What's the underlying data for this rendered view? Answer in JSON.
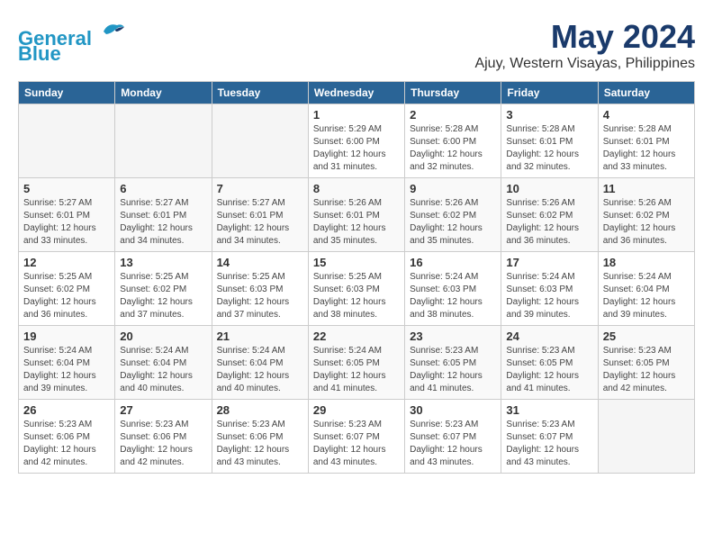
{
  "header": {
    "logo_line1": "General",
    "logo_line2": "Blue",
    "main_title": "May 2024",
    "subtitle": "Ajuy, Western Visayas, Philippines"
  },
  "days_of_week": [
    "Sunday",
    "Monday",
    "Tuesday",
    "Wednesday",
    "Thursday",
    "Friday",
    "Saturday"
  ],
  "weeks": [
    [
      {
        "day": "",
        "info": ""
      },
      {
        "day": "",
        "info": ""
      },
      {
        "day": "",
        "info": ""
      },
      {
        "day": "1",
        "info": "Sunrise: 5:29 AM\nSunset: 6:00 PM\nDaylight: 12 hours\nand 31 minutes."
      },
      {
        "day": "2",
        "info": "Sunrise: 5:28 AM\nSunset: 6:00 PM\nDaylight: 12 hours\nand 32 minutes."
      },
      {
        "day": "3",
        "info": "Sunrise: 5:28 AM\nSunset: 6:01 PM\nDaylight: 12 hours\nand 32 minutes."
      },
      {
        "day": "4",
        "info": "Sunrise: 5:28 AM\nSunset: 6:01 PM\nDaylight: 12 hours\nand 33 minutes."
      }
    ],
    [
      {
        "day": "5",
        "info": "Sunrise: 5:27 AM\nSunset: 6:01 PM\nDaylight: 12 hours\nand 33 minutes."
      },
      {
        "day": "6",
        "info": "Sunrise: 5:27 AM\nSunset: 6:01 PM\nDaylight: 12 hours\nand 34 minutes."
      },
      {
        "day": "7",
        "info": "Sunrise: 5:27 AM\nSunset: 6:01 PM\nDaylight: 12 hours\nand 34 minutes."
      },
      {
        "day": "8",
        "info": "Sunrise: 5:26 AM\nSunset: 6:01 PM\nDaylight: 12 hours\nand 35 minutes."
      },
      {
        "day": "9",
        "info": "Sunrise: 5:26 AM\nSunset: 6:02 PM\nDaylight: 12 hours\nand 35 minutes."
      },
      {
        "day": "10",
        "info": "Sunrise: 5:26 AM\nSunset: 6:02 PM\nDaylight: 12 hours\nand 36 minutes."
      },
      {
        "day": "11",
        "info": "Sunrise: 5:26 AM\nSunset: 6:02 PM\nDaylight: 12 hours\nand 36 minutes."
      }
    ],
    [
      {
        "day": "12",
        "info": "Sunrise: 5:25 AM\nSunset: 6:02 PM\nDaylight: 12 hours\nand 36 minutes."
      },
      {
        "day": "13",
        "info": "Sunrise: 5:25 AM\nSunset: 6:02 PM\nDaylight: 12 hours\nand 37 minutes."
      },
      {
        "day": "14",
        "info": "Sunrise: 5:25 AM\nSunset: 6:03 PM\nDaylight: 12 hours\nand 37 minutes."
      },
      {
        "day": "15",
        "info": "Sunrise: 5:25 AM\nSunset: 6:03 PM\nDaylight: 12 hours\nand 38 minutes."
      },
      {
        "day": "16",
        "info": "Sunrise: 5:24 AM\nSunset: 6:03 PM\nDaylight: 12 hours\nand 38 minutes."
      },
      {
        "day": "17",
        "info": "Sunrise: 5:24 AM\nSunset: 6:03 PM\nDaylight: 12 hours\nand 39 minutes."
      },
      {
        "day": "18",
        "info": "Sunrise: 5:24 AM\nSunset: 6:04 PM\nDaylight: 12 hours\nand 39 minutes."
      }
    ],
    [
      {
        "day": "19",
        "info": "Sunrise: 5:24 AM\nSunset: 6:04 PM\nDaylight: 12 hours\nand 39 minutes."
      },
      {
        "day": "20",
        "info": "Sunrise: 5:24 AM\nSunset: 6:04 PM\nDaylight: 12 hours\nand 40 minutes."
      },
      {
        "day": "21",
        "info": "Sunrise: 5:24 AM\nSunset: 6:04 PM\nDaylight: 12 hours\nand 40 minutes."
      },
      {
        "day": "22",
        "info": "Sunrise: 5:24 AM\nSunset: 6:05 PM\nDaylight: 12 hours\nand 41 minutes."
      },
      {
        "day": "23",
        "info": "Sunrise: 5:23 AM\nSunset: 6:05 PM\nDaylight: 12 hours\nand 41 minutes."
      },
      {
        "day": "24",
        "info": "Sunrise: 5:23 AM\nSunset: 6:05 PM\nDaylight: 12 hours\nand 41 minutes."
      },
      {
        "day": "25",
        "info": "Sunrise: 5:23 AM\nSunset: 6:05 PM\nDaylight: 12 hours\nand 42 minutes."
      }
    ],
    [
      {
        "day": "26",
        "info": "Sunrise: 5:23 AM\nSunset: 6:06 PM\nDaylight: 12 hours\nand 42 minutes."
      },
      {
        "day": "27",
        "info": "Sunrise: 5:23 AM\nSunset: 6:06 PM\nDaylight: 12 hours\nand 42 minutes."
      },
      {
        "day": "28",
        "info": "Sunrise: 5:23 AM\nSunset: 6:06 PM\nDaylight: 12 hours\nand 43 minutes."
      },
      {
        "day": "29",
        "info": "Sunrise: 5:23 AM\nSunset: 6:07 PM\nDaylight: 12 hours\nand 43 minutes."
      },
      {
        "day": "30",
        "info": "Sunrise: 5:23 AM\nSunset: 6:07 PM\nDaylight: 12 hours\nand 43 minutes."
      },
      {
        "day": "31",
        "info": "Sunrise: 5:23 AM\nSunset: 6:07 PM\nDaylight: 12 hours\nand 43 minutes."
      },
      {
        "day": "",
        "info": ""
      }
    ]
  ]
}
